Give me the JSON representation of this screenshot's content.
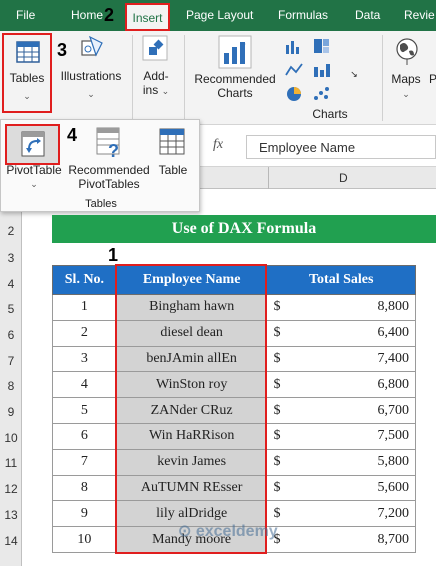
{
  "ribbon": {
    "tabs": [
      "File",
      "Home",
      "Insert",
      "Page Layout",
      "Formulas",
      "Data",
      "Revie"
    ],
    "active_tab": "Insert",
    "groups": {
      "tables_button": "Tables",
      "illustrations_button": "Illustrations",
      "addins_button": "Add-\nins",
      "recommended_charts_line1": "Recommended",
      "recommended_charts_line2": "Charts",
      "maps_button": "Maps",
      "charts_group_label": "Charts"
    }
  },
  "tables_dropdown": {
    "pivottable_label": "PivotTable",
    "recommended_pivot_line1": "Recommended",
    "recommended_pivot_line2": "PivotTables",
    "table_label": "Table",
    "group_label": "Tables"
  },
  "formula_bar": {
    "fx_label": "fx",
    "content": "Employee Name"
  },
  "grid": {
    "column_letter": "D",
    "row_numbers": [
      "2",
      "3",
      "4",
      "5",
      "6",
      "7",
      "8",
      "9",
      "10",
      "11",
      "12",
      "13",
      "14"
    ]
  },
  "steps": {
    "one": "1",
    "two": "2",
    "three": "3",
    "four": "4"
  },
  "sheet": {
    "title": "Use of DAX Formula",
    "headers": [
      "Sl. No.",
      "Employee Name",
      "Total Sales"
    ],
    "currency": "$",
    "rows": [
      {
        "no": "1",
        "name": "Bingham hawn",
        "sales": "8,800"
      },
      {
        "no": "2",
        "name": "diesel dean",
        "sales": "6,400"
      },
      {
        "no": "3",
        "name": "benJAmin allEn",
        "sales": "7,400"
      },
      {
        "no": "4",
        "name": "WinSton roy",
        "sales": "6,800"
      },
      {
        "no": "5",
        "name": "ZANder CRuz",
        "sales": "6,700"
      },
      {
        "no": "6",
        "name": "Win HaRRison",
        "sales": "7,500"
      },
      {
        "no": "7",
        "name": "kevin James",
        "sales": "5,800"
      },
      {
        "no": "8",
        "name": "AuTUMN REsser",
        "sales": "5,600"
      },
      {
        "no": "9",
        "name": "lily alDridge",
        "sales": "7,200"
      },
      {
        "no": "10",
        "name": "Mandy moore",
        "sales": "8,700"
      }
    ]
  },
  "watermark": "exceldemy",
  "colors": {
    "ribbon_green": "#217346",
    "title_green": "#21a050",
    "header_blue": "#1f6fc5",
    "highlight_red": "#e01e1e",
    "name_cell_gray": "#d3d3d3"
  }
}
